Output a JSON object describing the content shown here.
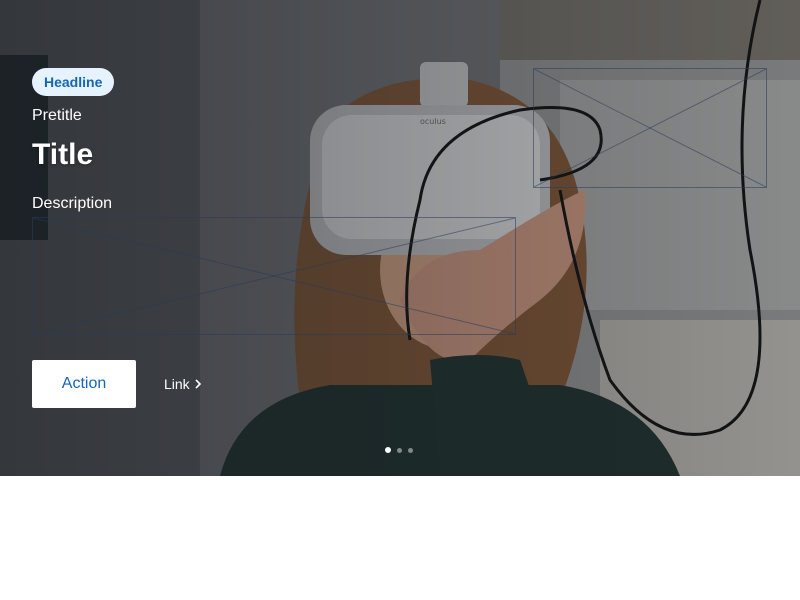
{
  "hero": {
    "headline_badge": "Headline",
    "pretitle": "Pretitle",
    "title": "Title",
    "description": "Description",
    "action_label": "Action",
    "link_label": "Link",
    "link_icon": "chevron-right-icon",
    "image_subject": "woman-wearing-vr-headset",
    "headset_brand": "oculus"
  },
  "carousel": {
    "slide_count": 3,
    "active_index": 0
  },
  "colors": {
    "accent": "#1565b8",
    "badge_bg": "#e7f2ff",
    "page_bg": "#ffffff",
    "hero_text": "#ffffff"
  }
}
